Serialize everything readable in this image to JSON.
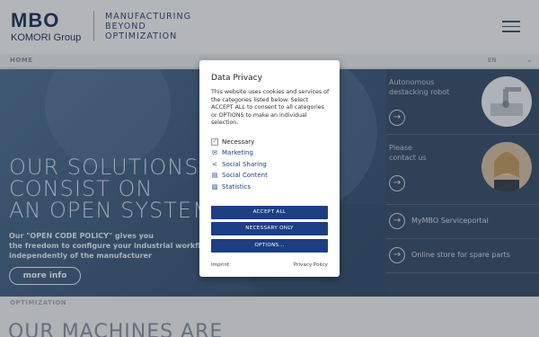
{
  "header": {
    "logo_main": "MBO",
    "logo_sub": "KOMORI Group",
    "tagline": [
      "MANUFACTURING",
      "BEYOND",
      "OPTIMIZATION"
    ]
  },
  "breadcrumb": {
    "home": "HOME",
    "language": "EN"
  },
  "hero": {
    "title_lines": [
      "OUR SOLUTIONS",
      "CONSIST ON",
      "AN OPEN SYSTEM"
    ],
    "text_lines": [
      "Our \"OPEN CODE POLICY\" gives you",
      "the freedom to configure your industrial workflow",
      "independently of the manufacturer"
    ],
    "more_info": "more info"
  },
  "side": {
    "robot_label": [
      "Autonomous",
      "destacking robot"
    ],
    "contact_label": [
      "Please",
      "contact us"
    ],
    "serviceportal": "MyMBO Serviceportal",
    "online_store": "Online store for spare parts"
  },
  "below": {
    "crumb": "OPTIMIZATION",
    "title": "OUR MACHINES ARE"
  },
  "modal": {
    "title": "Data Privacy",
    "description_lines": [
      "This website uses cookies and services of",
      "the categories listed below. Select",
      "ACCEPT ALL to consent to all categories",
      "or OPTIONS to make an individual",
      "selection."
    ],
    "options": [
      {
        "label": "Necessary",
        "icon": "check-icon",
        "color": "#222222"
      },
      {
        "label": "Marketing",
        "icon": "email-icon",
        "color": "#1c3f84"
      },
      {
        "label": "Social Sharing",
        "icon": "share-icon",
        "color": "#1c3f84"
      },
      {
        "label": "Social Content",
        "icon": "chat-icon",
        "color": "#1c3f84"
      },
      {
        "label": "Statistics",
        "icon": "bar-chart-icon",
        "color": "#1c3f84"
      }
    ],
    "accept_all": "ACCEPT ALL",
    "necessary_only": "NECESSARY ONLY",
    "options_button": "OPTIONS...",
    "imprint": "Imprint",
    "privacy_policy": "Privacy Policy"
  },
  "colors": {
    "brand_navy": "#1c3f84",
    "header_bg": "#e9ebec",
    "hero_bg": "#3a5578"
  }
}
